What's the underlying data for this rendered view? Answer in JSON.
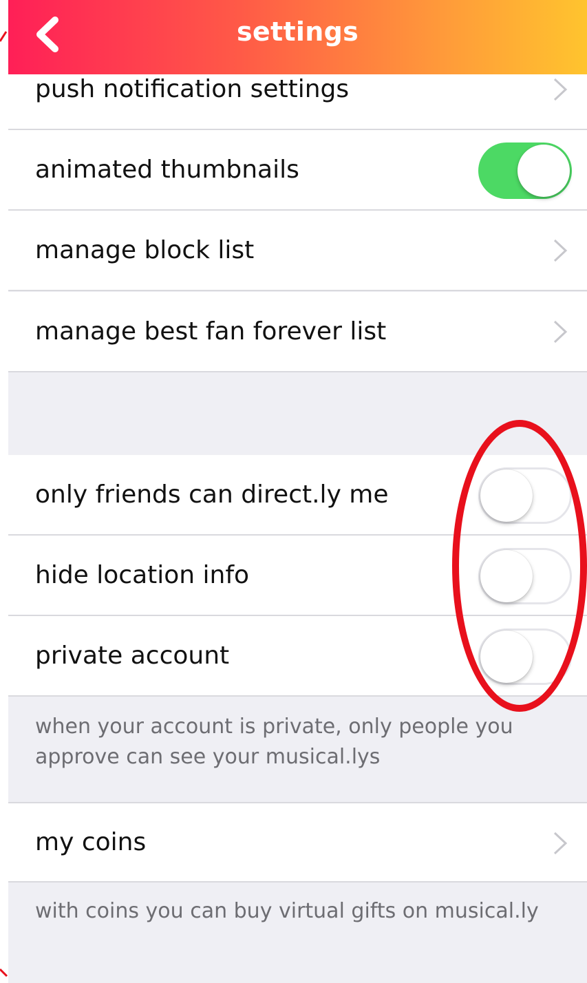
{
  "nav": {
    "title": "settings",
    "back_icon": "chevron-left-icon"
  },
  "rows": {
    "push_notifications": "push notification settings",
    "animated_thumbnails": "animated thumbnails",
    "manage_block_list": "manage block list",
    "manage_bff_list": "manage best fan forever list",
    "only_friends_direct": "only friends can direct.ly me",
    "hide_location": "hide location info",
    "private_account": "private account",
    "my_coins": "my coins"
  },
  "toggles": {
    "animated_thumbnails": true,
    "only_friends_direct": false,
    "hide_location": false,
    "private_account": false
  },
  "footnotes": {
    "private_account": "when your account is private, only people you approve can see your musical.lys",
    "coins": "with coins you can buy virtual gifts on musical.ly"
  },
  "colors": {
    "gradient_start": "#ff1f57",
    "gradient_end": "#ffc42e",
    "toggle_on": "#4cd964",
    "annotation": "#e8101c",
    "group_background": "#efeff4"
  }
}
